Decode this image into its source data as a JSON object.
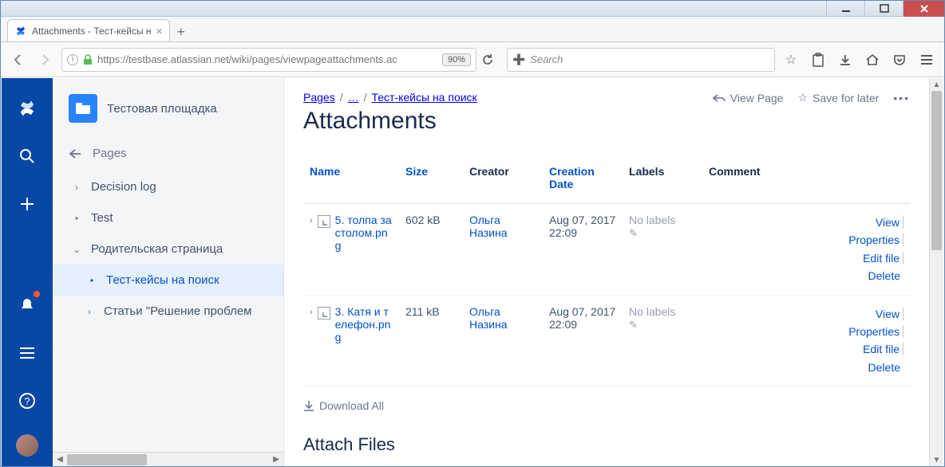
{
  "browser": {
    "tab_title": "Attachments - Тест-кейсы н",
    "url": "https://testbase.atlassian.net/wiki/pages/viewpageattachments.ac",
    "zoom": "90%",
    "search_placeholder": "Search"
  },
  "space": {
    "name": "Тестовая площадка"
  },
  "tree": {
    "pages_label": "Pages",
    "items": [
      {
        "label": "Decision log",
        "expand": "›"
      },
      {
        "label": "Test",
        "expand": "•"
      },
      {
        "label": "Родительская страница",
        "expand": "⌄"
      },
      {
        "label": "Тест-кейсы на поиск",
        "expand": "•",
        "selected": true
      },
      {
        "label": "Статьи \"Решение проблем",
        "expand": "›"
      }
    ]
  },
  "breadcrumb": {
    "root": "Pages",
    "mid": "…",
    "leaf": "Тест-кейсы на поиск"
  },
  "actions": {
    "view_page": "View Page",
    "save_later": "Save for later"
  },
  "page_title": "Attachments",
  "table": {
    "headers": {
      "name": "Name",
      "size": "Size",
      "creator": "Creator",
      "date": "Creation Date",
      "labels": "Labels",
      "comment": "Comment"
    },
    "rows": [
      {
        "name": "5. толпа за столом.png",
        "size": "602 kB",
        "creator": "Ольга Назина",
        "date": "Aug 07, 2017 22:09",
        "labels": "No labels"
      },
      {
        "name": "3. Катя и телефон.png",
        "size": "211 kB",
        "creator": "Ольга Назина",
        "date": "Aug 07, 2017 22:09",
        "labels": "No labels"
      }
    ],
    "row_actions": {
      "view": "View",
      "props": "Properties",
      "edit": "Edit file",
      "del": "Delete"
    }
  },
  "download_all": "Download All",
  "attach_heading": "Attach Files"
}
